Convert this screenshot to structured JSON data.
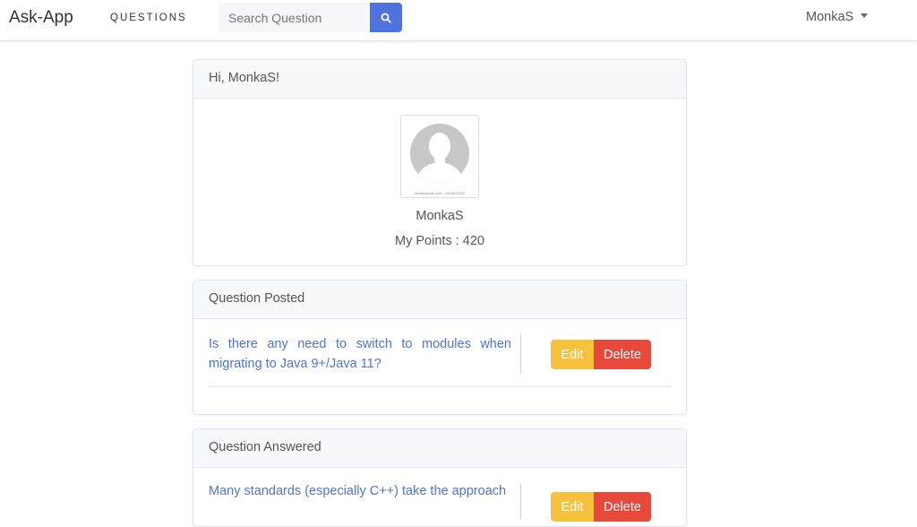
{
  "navbar": {
    "brand": "Ask-App",
    "questions_link": "QUESTIONS",
    "search": {
      "placeholder": "Search Question",
      "value": ""
    },
    "user_menu": "MonkaS"
  },
  "profile_card": {
    "greeting": "Hi, MonkaS!",
    "avatar_caption": "shutterstock.com • 1153673752",
    "name": "MonkaS",
    "points": "My Points : 420"
  },
  "posted_card": {
    "header": "Question Posted",
    "items": [
      {
        "text": "Is there any need to switch to modules when migrating to Java 9+/Java 11?",
        "edit": "Edit",
        "delete": "Delete"
      }
    ]
  },
  "answered_card": {
    "header": "Question Answered",
    "items": [
      {
        "text": "Many standards (especially C++) take the approach",
        "edit": "Edit",
        "delete": "Delete"
      }
    ]
  },
  "colors": {
    "primary": "#4e73df",
    "warning": "#f6c23e",
    "danger": "#e74a3b"
  },
  "icons": [
    "search-icon",
    "caret-down-icon",
    "avatar-placeholder-icon"
  ]
}
